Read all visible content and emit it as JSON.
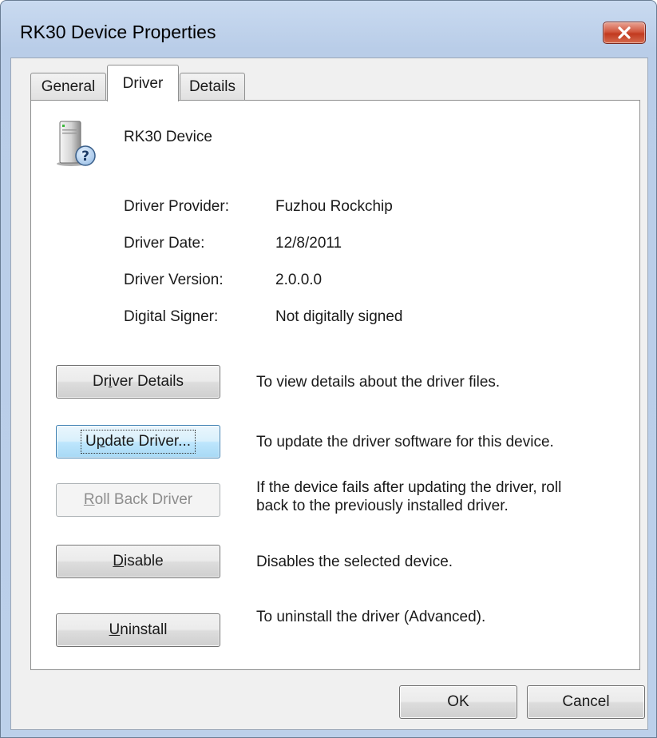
{
  "window": {
    "title": "RK30 Device Properties"
  },
  "tabs": [
    {
      "label": "General",
      "active": false
    },
    {
      "label": "Driver",
      "active": true
    },
    {
      "label": "Details",
      "active": false
    }
  ],
  "device": {
    "name": "RK30 Device",
    "icon": "device-unknown-icon"
  },
  "info": [
    {
      "label": "Driver Provider:",
      "value": "Fuzhou Rockchip"
    },
    {
      "label": "Driver Date:",
      "value": "12/8/2011"
    },
    {
      "label": "Driver Version:",
      "value": "2.0.0.0"
    },
    {
      "label": "Digital Signer:",
      "value": "Not digitally signed"
    }
  ],
  "actions": {
    "driver_details": {
      "pre": "Dr",
      "key": "i",
      "post": "ver Details",
      "desc": "To view details about the driver files."
    },
    "update_driver": {
      "pre": "U",
      "key": "p",
      "post": "date Driver...",
      "desc": "To update the driver software for this device."
    },
    "roll_back": {
      "pre": "",
      "key": "R",
      "post": "oll Back Driver",
      "desc_line1": "If the device fails after updating the driver, roll",
      "desc_line2": "back to the previously installed driver."
    },
    "disable": {
      "pre": "",
      "key": "D",
      "post": "isable",
      "desc": "Disables the selected device."
    },
    "uninstall": {
      "pre": "",
      "key": "U",
      "post": "ninstall",
      "desc": "To uninstall the driver (Advanced)."
    }
  },
  "footer": {
    "ok": "OK",
    "cancel": "Cancel"
  },
  "colors": {
    "accent": "#3c7fb1",
    "close": "#c23a1f",
    "frame": "#bcd0ea"
  }
}
